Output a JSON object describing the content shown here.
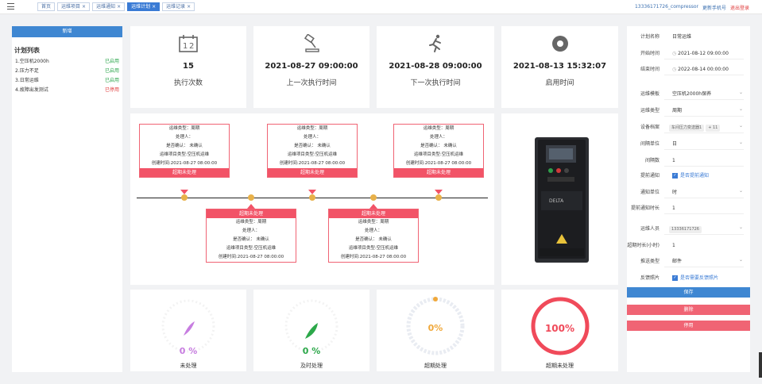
{
  "tabs": [
    {
      "label": "首页",
      "closable": false,
      "active": false
    },
    {
      "label": "运维项目",
      "closable": true,
      "active": false
    },
    {
      "label": "运维通知",
      "closable": true,
      "active": false
    },
    {
      "label": "运维计划",
      "closable": true,
      "active": true
    },
    {
      "label": "运维记录",
      "closable": true,
      "active": false
    }
  ],
  "user": {
    "phone": "13336171726_compressor",
    "change_phone": "更新手机号",
    "logout": "退出登录"
  },
  "left_panel": {
    "add_button": "新增",
    "title": "计划列表",
    "items": [
      {
        "name": "1.空压机2000h",
        "status": "已启用",
        "enabled": true
      },
      {
        "name": "2.压力不足",
        "status": "已启用",
        "enabled": true
      },
      {
        "name": "3.日常运维",
        "status": "已启用",
        "enabled": true
      },
      {
        "name": "4.故障出发测试",
        "status": "已停用",
        "enabled": false
      }
    ]
  },
  "stats": [
    {
      "icon": "calendar-icon",
      "value": "15",
      "label": "执行次数"
    },
    {
      "icon": "gavel-icon",
      "value": "2021-08-27 09:00:00",
      "label": "上一次执行时间"
    },
    {
      "icon": "running-man-icon",
      "value": "2021-08-28 09:00:00",
      "label": "下一次执行时间"
    },
    {
      "icon": "record-icon",
      "value": "2021-08-13 15:32:07",
      "label": "启用时间"
    }
  ],
  "timeline": {
    "top_events": [
      {
        "type": "运维类型：周期",
        "handler": "处理人：",
        "confirm": "是否确认： 未确认",
        "project_type": "运维项目类型:空压机运维",
        "created": "创建时间:2021-08-27 08:00:00",
        "tag": "超期未处理"
      },
      {
        "type": "运维类型：周期",
        "handler": "处理人：",
        "confirm": "是否确认： 未确认",
        "project_type": "运维项目类型:空压机运维",
        "created": "创建时间:2021-08-27 08:00:00",
        "tag": "超期未处理"
      },
      {
        "type": "运维类型：周期",
        "handler": "处理人：",
        "confirm": "是否确认： 未确认",
        "project_type": "运维项目类型:空压机运维",
        "created": "创建时间:2021-08-27 08:00:00",
        "tag": "超期未处理"
      }
    ],
    "bottom_events": [
      {
        "type": "运维类型：周期",
        "handler": "处理人：",
        "confirm": "是否确认： 未确认",
        "project_type": "运维项目类型:空压机运维",
        "created": "创建时间:2021-08-27 08:00:00",
        "tag": "超期未处理"
      },
      {
        "type": "运维类型：周期",
        "handler": "处理人：",
        "confirm": "是否确认： 未确认",
        "project_type": "运维项目类型:空压机运维",
        "created": "创建时间:2021-08-27 08:00:00",
        "tag": "超期未处理"
      }
    ]
  },
  "device": {
    "brand": "DELTA"
  },
  "progress": [
    {
      "value": "0 %",
      "fraction": 0,
      "label": "未处理",
      "color": "#c77de0",
      "style": "leaf"
    },
    {
      "value": "0 %",
      "fraction": 0,
      "label": "及时处理",
      "color": "#2ca84a",
      "style": "leaf"
    },
    {
      "value": "0%",
      "fraction": 0,
      "label": "超期处理",
      "color": "#f0a83a",
      "style": "ring"
    },
    {
      "value": "100%",
      "fraction": 1,
      "label": "超期未处理",
      "color": "#f04a5a",
      "style": "ring"
    }
  ],
  "form": {
    "plan_name_label": "计划名称",
    "plan_name": "日常运维",
    "start_label": "开始时间",
    "start": "2021-08-12 09:00:00",
    "end_label": "结束时间",
    "end": "2022-08-14 00:00:00",
    "template_label": "运维模板",
    "template": "空压机2000h保养",
    "type_label": "运维类型",
    "type": "周期",
    "device_label": "设备档案",
    "device_chip": "车间压力变送器1",
    "device_more": "+ 11",
    "interval_unit_label": "间隔单位",
    "interval_unit": "日",
    "interval_label": "间隔数",
    "interval": "1",
    "advance_label": "提前通知",
    "advance": "是否提前通知",
    "notice_unit_label": "通知单位",
    "notice_unit": "时",
    "notice_len_label": "提前通知时长",
    "notice_len": "1",
    "person_label": "运维人员",
    "person_chip": "13336171726",
    "overdue_label": "超期时长(小时)",
    "overdue": "1",
    "push_label": "推送类型",
    "push": "邮件",
    "feedback_label": "反馈照片",
    "feedback": "是否需要反馈照片"
  },
  "buttons": {
    "save": "保存",
    "delete": "删除",
    "stop": "停用"
  },
  "colors": {
    "primary": "#3f87d2",
    "danger": "#f25367",
    "success": "#2aa54a",
    "timeline_dot": "#e8b14a"
  }
}
